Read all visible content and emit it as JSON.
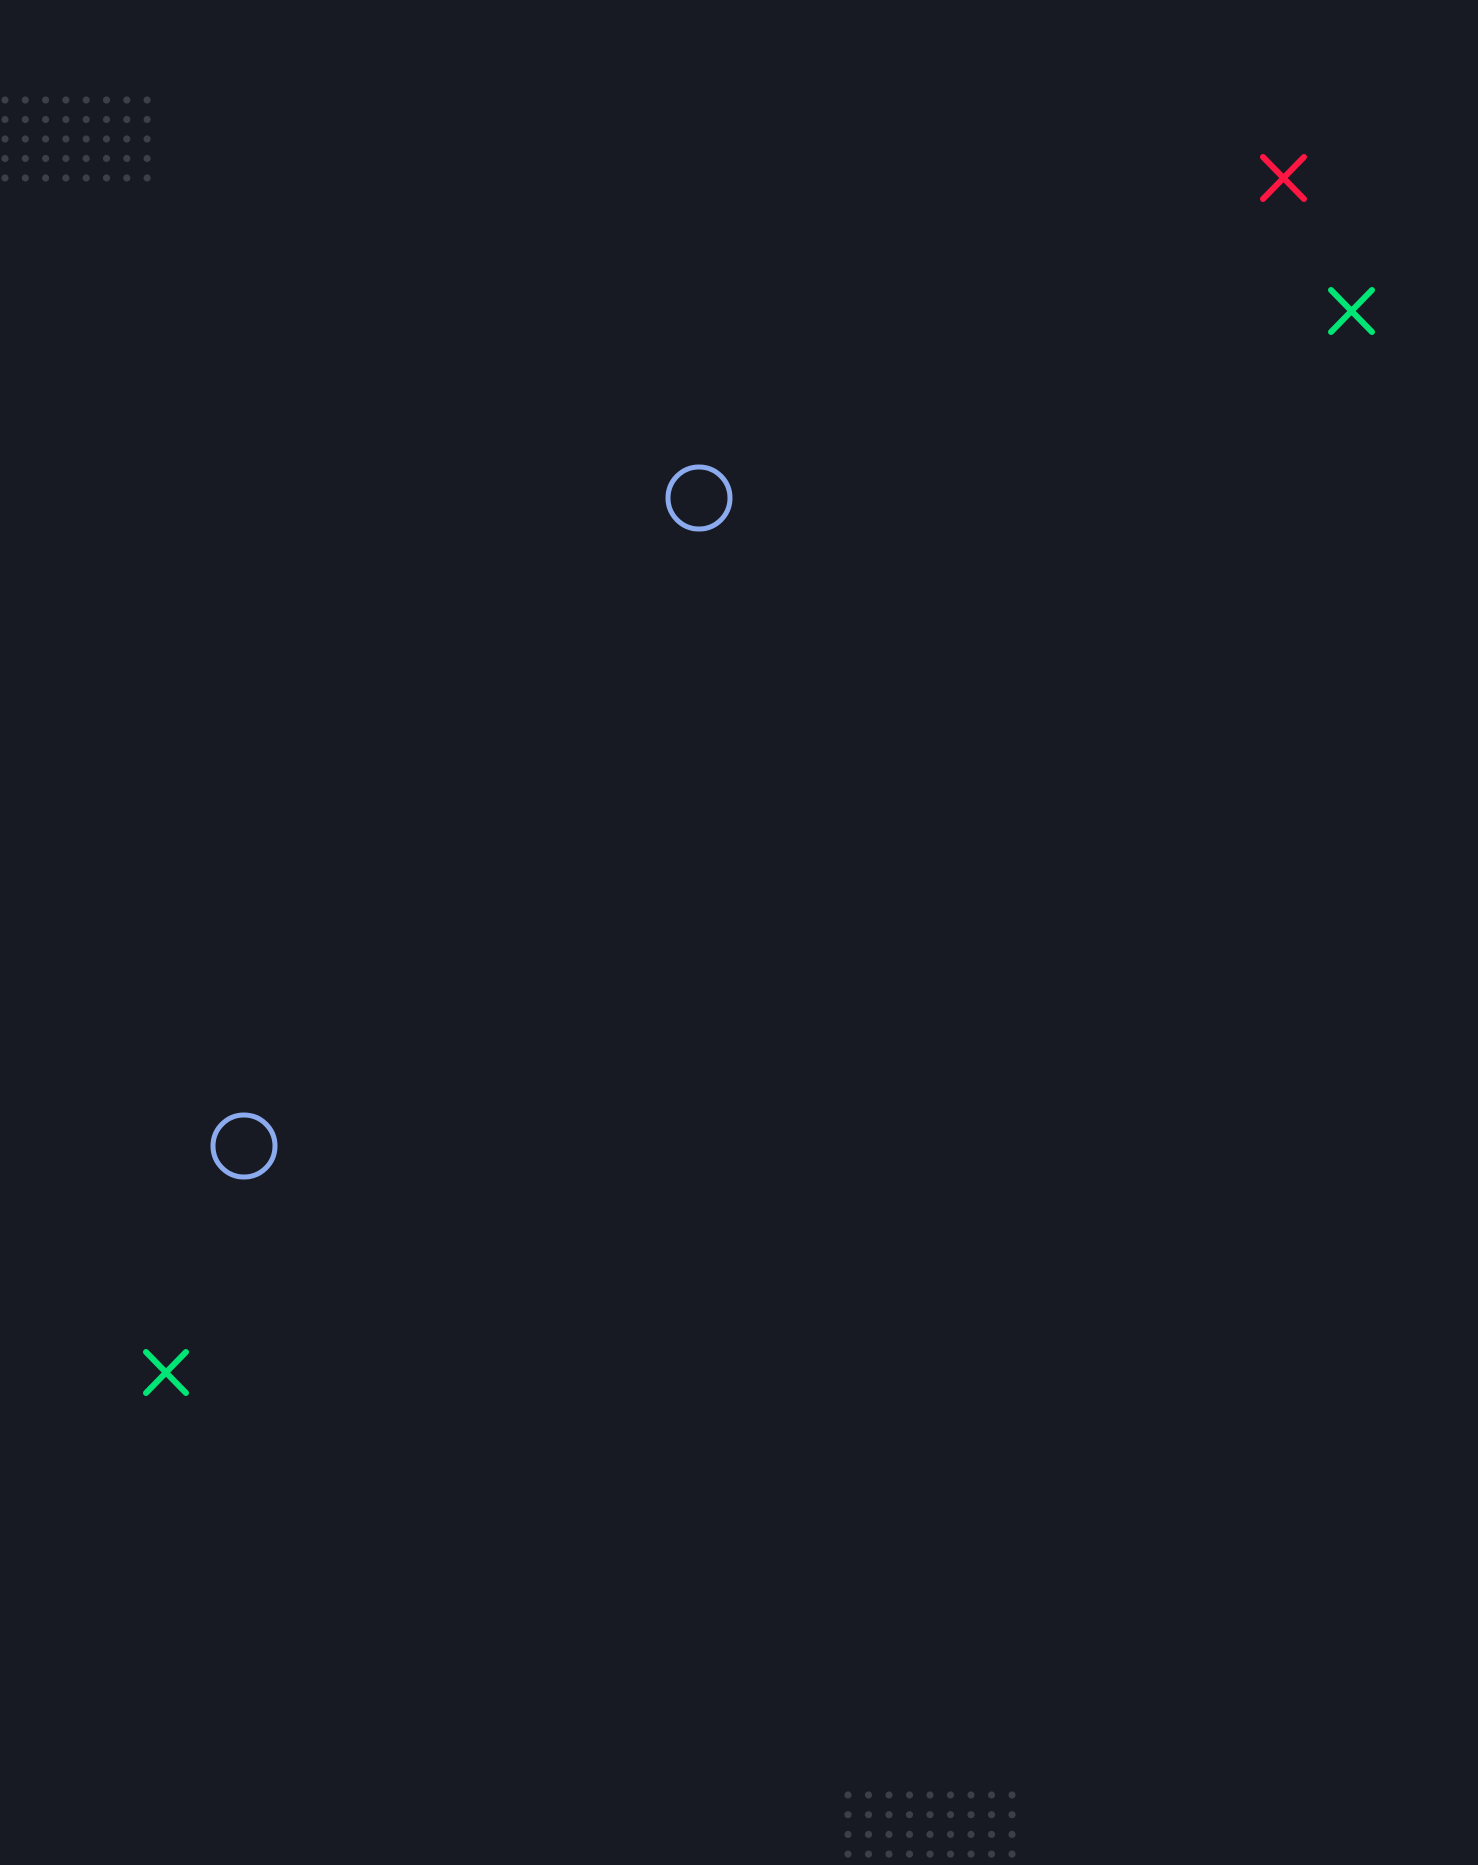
{
  "background_color": "#171a22",
  "colors": {
    "dot": "#3a3f49",
    "circle": "#8caaee",
    "cross_red": "#ff1744",
    "cross_green": "#00e676"
  },
  "icons": [
    "dot-grid-pattern-top-left",
    "red-cross-icon",
    "green-cross-icon-top-right",
    "blue-circle-icon-center",
    "blue-circle-icon-lower-left",
    "green-cross-icon-lower-left",
    "dot-grid-pattern-bottom"
  ]
}
